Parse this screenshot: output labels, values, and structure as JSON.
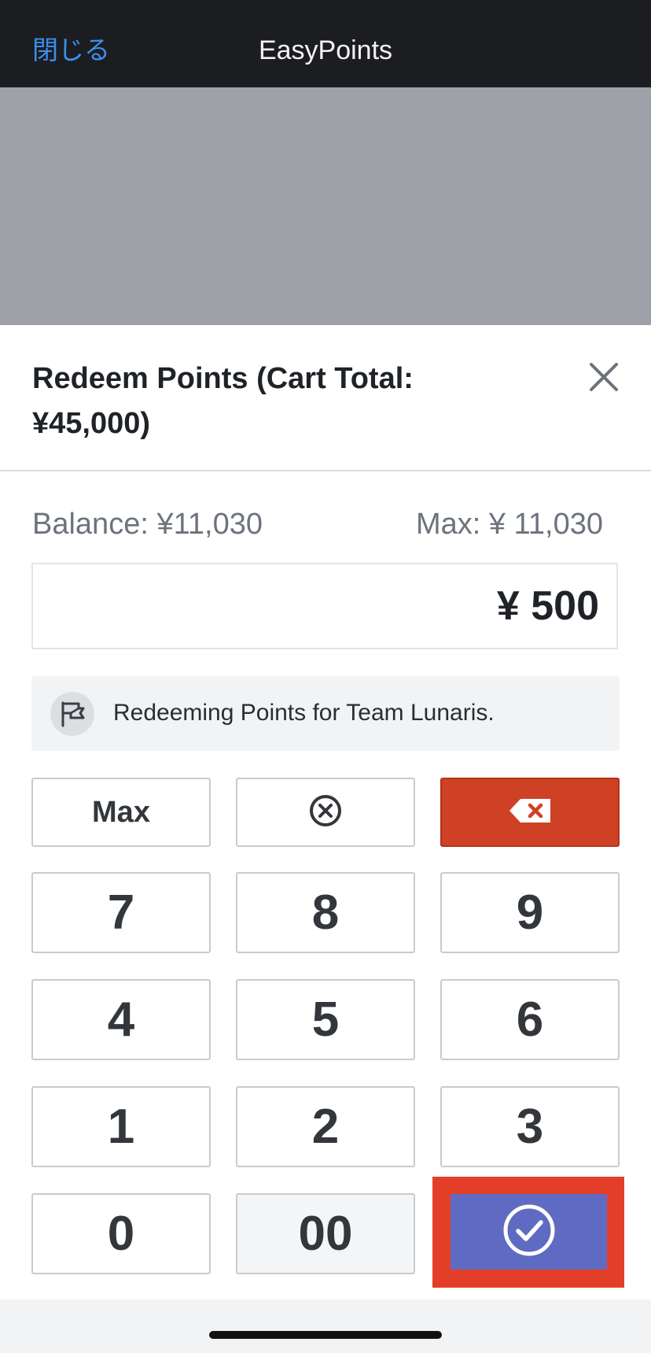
{
  "nav": {
    "close_label": "閉じる",
    "title": "EasyPoints"
  },
  "sheet": {
    "title": "Redeem Points (Cart Total: ¥45,000)",
    "balance": "Balance: ¥11,030",
    "max": "Max: ¥ 11,030",
    "amount": "¥ 500",
    "notice": "Redeeming Points for Team Lunaris."
  },
  "keypad": {
    "max_label": "Max",
    "keys": [
      "7",
      "8",
      "9",
      "4",
      "5",
      "6",
      "1",
      "2",
      "3",
      "0",
      "00"
    ]
  },
  "colors": {
    "accent": "#3b8ef0",
    "danger": "#cf4124",
    "confirm": "#5f6bc2",
    "highlight": "#e33f28"
  },
  "icons": [
    "close-icon",
    "flag-icon",
    "clear-icon",
    "backspace-icon",
    "checkmark-icon"
  ]
}
